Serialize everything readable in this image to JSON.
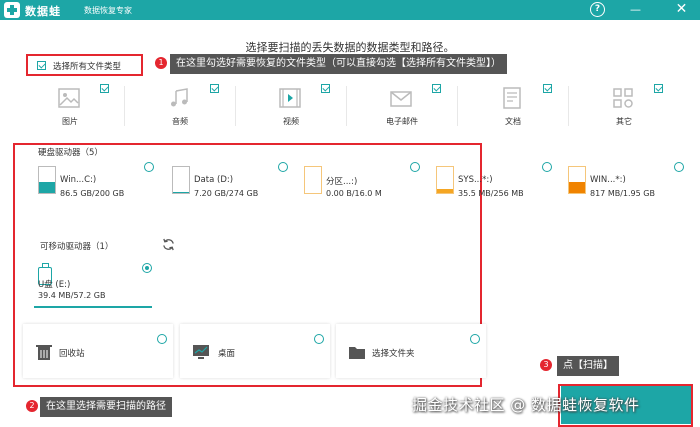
{
  "app": {
    "brand": "数据蛙",
    "tagline": "数据恢复专家"
  },
  "window": {
    "help": "?",
    "minimize": "—",
    "close": "✕"
  },
  "heading": "选择要扫描的丢失数据的数据类型和路径。",
  "select_all": {
    "label": "选择所有文件类型",
    "checked": true
  },
  "annotations": {
    "a1": {
      "num": "1",
      "text": "在这里勾选好需要恢复的文件类型（可以直接勾选【选择所有文件类型】）"
    },
    "a2": {
      "num": "2",
      "text": "在这里选择需要扫描的路径"
    },
    "a3": {
      "num": "3",
      "text": "点【扫描】"
    }
  },
  "file_types": [
    {
      "label": "图片",
      "icon": "image-icon",
      "checked": true
    },
    {
      "label": "音频",
      "icon": "music-icon",
      "checked": true
    },
    {
      "label": "视频",
      "icon": "video-icon",
      "checked": true
    },
    {
      "label": "电子邮件",
      "icon": "email-icon",
      "checked": true
    },
    {
      "label": "文档",
      "icon": "document-icon",
      "checked": true
    },
    {
      "label": "其它",
      "icon": "other-icon",
      "checked": true
    }
  ],
  "hard_drives": {
    "label": "硬盘驱动器（5）",
    "items": [
      {
        "name": "Win...C:)",
        "size": "86.5 GB/200 GB",
        "used": 0.43,
        "color": "#1da6a6"
      },
      {
        "name": "Data (D:)",
        "size": "7.20 GB/274 GB",
        "used": 0.03,
        "color": "#1da6a6"
      },
      {
        "name": "分区...:)",
        "size": "0.00  B/16.0 M",
        "used": 0.0,
        "color": "#f5a623"
      },
      {
        "name": "SYS...*:)",
        "size": "35.5 MB/256 MB",
        "used": 0.14,
        "color": "#f5a623"
      },
      {
        "name": "WIN...*:)",
        "size": "817 MB/1.95 GB",
        "used": 0.42,
        "color": "#f08300"
      }
    ]
  },
  "removable": {
    "label": "可移动驱动器（1）",
    "refresh_icon": "refresh-icon",
    "items": [
      {
        "name": "U盘 (E:)",
        "size": "39.4 MB/57.2 GB",
        "selected": true
      }
    ]
  },
  "locations": [
    {
      "label": "回收站",
      "icon": "recycle-bin-icon"
    },
    {
      "label": "桌面",
      "icon": "desktop-icon"
    },
    {
      "label": "选择文件夹",
      "icon": "folder-icon"
    }
  ],
  "watermark": "掘金技术社区 @ 数据蛙恢复软件",
  "colors": {
    "accent": "#1da6a6",
    "annotation_red": "#e4262f",
    "callout_bg": "#555555"
  }
}
